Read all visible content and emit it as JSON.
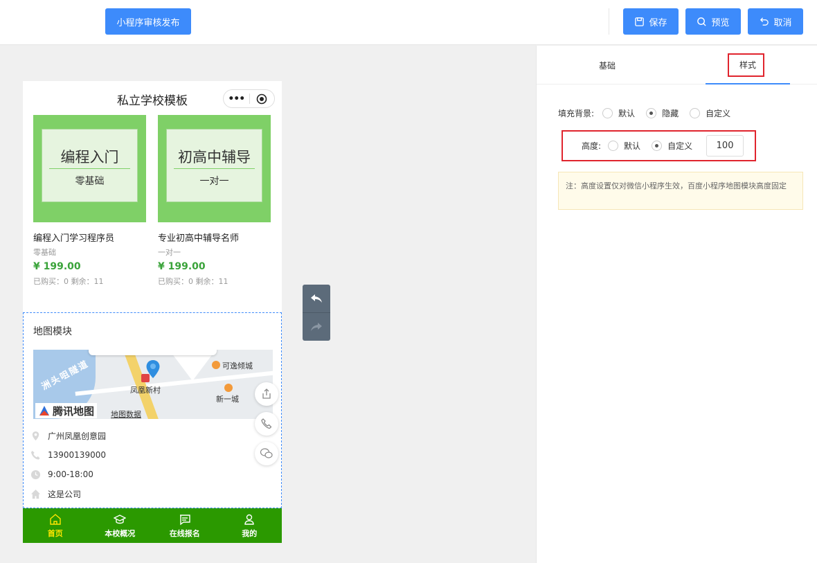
{
  "toolbar": {
    "publish_label": "小程序审核发布",
    "save_label": "保存",
    "preview_label": "预览",
    "cancel_label": "取消"
  },
  "phone": {
    "title": "私立学校模板",
    "courses": [
      {
        "thumb_title": "编程入门",
        "thumb_sub": "零基础",
        "name": "编程入门学习程序员",
        "tag": "零基础",
        "price": "¥ 199.00",
        "stat": "已购买：0 剩余：11"
      },
      {
        "thumb_title": "初高中辅导",
        "thumb_sub": "一对一",
        "name": "专业初高中辅导名师",
        "tag": "一对一",
        "price": "¥ 199.00",
        "stat": "已购买：0 剩余：11"
      }
    ],
    "map_module": {
      "title": "地图模块",
      "map_labels": {
        "road": "洲头咀隧道",
        "center": "凤凰新村",
        "poi1": "可逸倾城",
        "poi2": "新一城",
        "logo": "腾讯地图",
        "data_link": "地图数据"
      },
      "address": "广州凤凰创意园",
      "phone": "13900139000",
      "hours": "9:00-18:00",
      "description": "这是公司"
    },
    "tabbar": [
      {
        "label": "首页",
        "icon": "home-icon",
        "active": true
      },
      {
        "label": "本校概况",
        "icon": "graduation-cap-icon",
        "active": false
      },
      {
        "label": "在线报名",
        "icon": "message-icon",
        "active": false
      },
      {
        "label": "我的",
        "icon": "user-icon",
        "active": false
      }
    ]
  },
  "panel": {
    "tabs": [
      {
        "label": "基础",
        "active": false
      },
      {
        "label": "样式",
        "active": true
      }
    ],
    "fill_background": {
      "label": "填充背景:",
      "options": [
        "默认",
        "隐藏",
        "自定义"
      ],
      "selected": "隐藏"
    },
    "height": {
      "label": "高度:",
      "options": [
        "默认",
        "自定义"
      ],
      "selected": "自定义",
      "value": "100"
    },
    "note": "注：高度设置仅对微信小程序生效，百度小程序地图模块高度固定"
  },
  "colors": {
    "primary": "#3d8bfb",
    "tabbar_bg": "#2b9900",
    "tabbar_active": "#ffe600",
    "price": "#3aa33a",
    "highlight_border": "#e0242d"
  }
}
